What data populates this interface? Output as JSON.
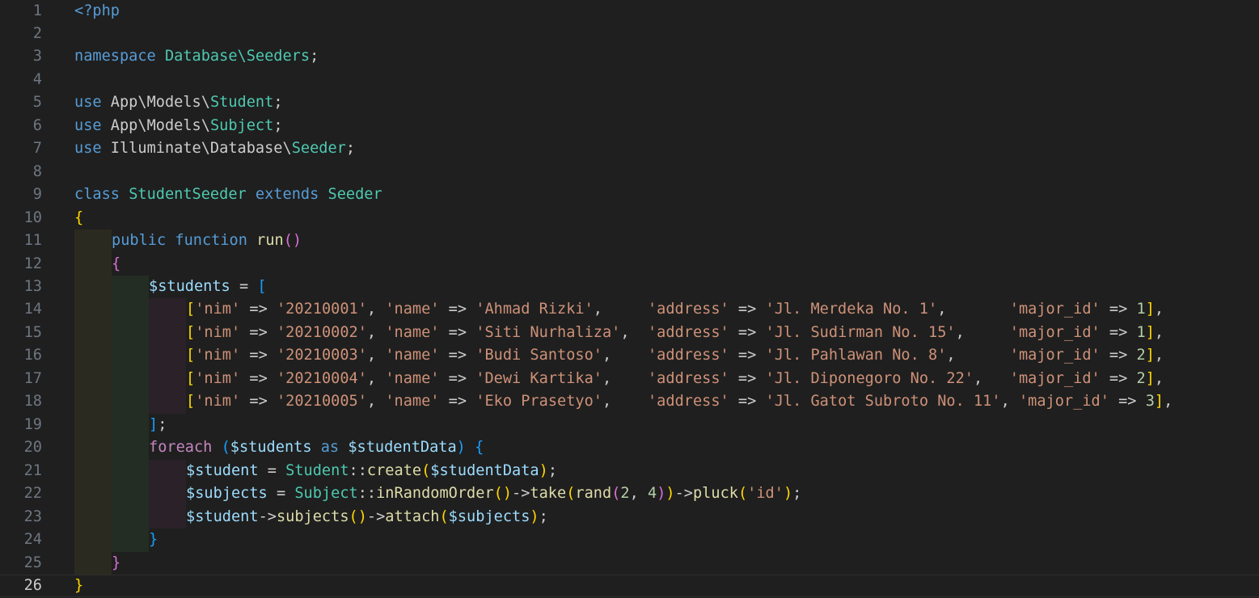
{
  "editor": {
    "language": "php",
    "current_line": 26,
    "colors": {
      "background": "#1f1f1f",
      "keyword": "#569cd6",
      "control": "#c586c0",
      "type": "#4ec9b0",
      "func": "#dcdcaa",
      "variable": "#9cdcfe",
      "string": "#ce9178",
      "number": "#b5cea8",
      "text": "#cccccc",
      "bracket1": "#ffd700",
      "bracket2": "#da70d6",
      "bracket3": "#179fff"
    },
    "lines": [
      {
        "n": "1",
        "indent": 0,
        "tokens": [
          [
            "<?php",
            "keyword"
          ]
        ]
      },
      {
        "n": "2",
        "indent": 0,
        "tokens": []
      },
      {
        "n": "3",
        "indent": 0,
        "tokens": [
          [
            "namespace",
            "keyword"
          ],
          [
            " ",
            "text"
          ],
          [
            "Database\\Seeders",
            "type"
          ],
          [
            ";",
            "text"
          ]
        ]
      },
      {
        "n": "4",
        "indent": 0,
        "tokens": []
      },
      {
        "n": "5",
        "indent": 0,
        "tokens": [
          [
            "use",
            "keyword"
          ],
          [
            " App\\Models\\",
            "text"
          ],
          [
            "Student",
            "type"
          ],
          [
            ";",
            "text"
          ]
        ]
      },
      {
        "n": "6",
        "indent": 0,
        "tokens": [
          [
            "use",
            "keyword"
          ],
          [
            " App\\Models\\",
            "text"
          ],
          [
            "Subject",
            "type"
          ],
          [
            ";",
            "text"
          ]
        ]
      },
      {
        "n": "7",
        "indent": 0,
        "tokens": [
          [
            "use",
            "keyword"
          ],
          [
            " Illuminate\\Database\\",
            "text"
          ],
          [
            "Seeder",
            "type"
          ],
          [
            ";",
            "text"
          ]
        ]
      },
      {
        "n": "8",
        "indent": 0,
        "tokens": []
      },
      {
        "n": "9",
        "indent": 0,
        "tokens": [
          [
            "class",
            "keyword"
          ],
          [
            " ",
            "text"
          ],
          [
            "StudentSeeder",
            "type"
          ],
          [
            " ",
            "text"
          ],
          [
            "extends",
            "keyword"
          ],
          [
            " ",
            "text"
          ],
          [
            "Seeder",
            "type"
          ]
        ]
      },
      {
        "n": "10",
        "indent": 0,
        "tokens": [
          [
            "{",
            "bracket1"
          ]
        ]
      },
      {
        "n": "11",
        "indent": 1,
        "tokens": [
          [
            "public",
            "keyword"
          ],
          [
            " ",
            "text"
          ],
          [
            "function",
            "keyword"
          ],
          [
            " ",
            "text"
          ],
          [
            "run",
            "func"
          ],
          [
            "()",
            "bracket2"
          ]
        ]
      },
      {
        "n": "12",
        "indent": 1,
        "tokens": [
          [
            "{",
            "bracket2"
          ]
        ]
      },
      {
        "n": "13",
        "indent": 2,
        "tokens": [
          [
            "$students",
            "variable"
          ],
          [
            " = ",
            "text"
          ],
          [
            "[",
            "bracket3"
          ]
        ]
      },
      {
        "n": "14",
        "indent": 3,
        "tokens": [
          [
            "[",
            "bracket1"
          ],
          [
            "'nim'",
            "string"
          ],
          [
            " => ",
            "text"
          ],
          [
            "'20210001'",
            "string"
          ],
          [
            ", ",
            "text"
          ],
          [
            "'name'",
            "string"
          ],
          [
            " => ",
            "text"
          ],
          [
            "'Ahmad Rizki'",
            "string"
          ],
          [
            ",     ",
            "text"
          ],
          [
            "'address'",
            "string"
          ],
          [
            " => ",
            "text"
          ],
          [
            "'Jl. Merdeka No. 1'",
            "string"
          ],
          [
            ",       ",
            "text"
          ],
          [
            "'major_id'",
            "string"
          ],
          [
            " => ",
            "text"
          ],
          [
            "1",
            "number"
          ],
          [
            "]",
            "bracket1"
          ],
          [
            ",",
            "text"
          ]
        ]
      },
      {
        "n": "15",
        "indent": 3,
        "tokens": [
          [
            "[",
            "bracket1"
          ],
          [
            "'nim'",
            "string"
          ],
          [
            " => ",
            "text"
          ],
          [
            "'20210002'",
            "string"
          ],
          [
            ", ",
            "text"
          ],
          [
            "'name'",
            "string"
          ],
          [
            " => ",
            "text"
          ],
          [
            "'Siti Nurhaliza'",
            "string"
          ],
          [
            ",  ",
            "text"
          ],
          [
            "'address'",
            "string"
          ],
          [
            " => ",
            "text"
          ],
          [
            "'Jl. Sudirman No. 15'",
            "string"
          ],
          [
            ",     ",
            "text"
          ],
          [
            "'major_id'",
            "string"
          ],
          [
            " => ",
            "text"
          ],
          [
            "1",
            "number"
          ],
          [
            "]",
            "bracket1"
          ],
          [
            ",",
            "text"
          ]
        ]
      },
      {
        "n": "16",
        "indent": 3,
        "tokens": [
          [
            "[",
            "bracket1"
          ],
          [
            "'nim'",
            "string"
          ],
          [
            " => ",
            "text"
          ],
          [
            "'20210003'",
            "string"
          ],
          [
            ", ",
            "text"
          ],
          [
            "'name'",
            "string"
          ],
          [
            " => ",
            "text"
          ],
          [
            "'Budi Santoso'",
            "string"
          ],
          [
            ",    ",
            "text"
          ],
          [
            "'address'",
            "string"
          ],
          [
            " => ",
            "text"
          ],
          [
            "'Jl. Pahlawan No. 8'",
            "string"
          ],
          [
            ",      ",
            "text"
          ],
          [
            "'major_id'",
            "string"
          ],
          [
            " => ",
            "text"
          ],
          [
            "2",
            "number"
          ],
          [
            "]",
            "bracket1"
          ],
          [
            ",",
            "text"
          ]
        ]
      },
      {
        "n": "17",
        "indent": 3,
        "tokens": [
          [
            "[",
            "bracket1"
          ],
          [
            "'nim'",
            "string"
          ],
          [
            " => ",
            "text"
          ],
          [
            "'20210004'",
            "string"
          ],
          [
            ", ",
            "text"
          ],
          [
            "'name'",
            "string"
          ],
          [
            " => ",
            "text"
          ],
          [
            "'Dewi Kartika'",
            "string"
          ],
          [
            ",    ",
            "text"
          ],
          [
            "'address'",
            "string"
          ],
          [
            " => ",
            "text"
          ],
          [
            "'Jl. Diponegoro No. 22'",
            "string"
          ],
          [
            ",   ",
            "text"
          ],
          [
            "'major_id'",
            "string"
          ],
          [
            " => ",
            "text"
          ],
          [
            "2",
            "number"
          ],
          [
            "]",
            "bracket1"
          ],
          [
            ",",
            "text"
          ]
        ]
      },
      {
        "n": "18",
        "indent": 3,
        "tokens": [
          [
            "[",
            "bracket1"
          ],
          [
            "'nim'",
            "string"
          ],
          [
            " => ",
            "text"
          ],
          [
            "'20210005'",
            "string"
          ],
          [
            ", ",
            "text"
          ],
          [
            "'name'",
            "string"
          ],
          [
            " => ",
            "text"
          ],
          [
            "'Eko Prasetyo'",
            "string"
          ],
          [
            ",    ",
            "text"
          ],
          [
            "'address'",
            "string"
          ],
          [
            " => ",
            "text"
          ],
          [
            "'Jl. Gatot Subroto No. 11'",
            "string"
          ],
          [
            ", ",
            "text"
          ],
          [
            "'major_id'",
            "string"
          ],
          [
            " => ",
            "text"
          ],
          [
            "3",
            "number"
          ],
          [
            "]",
            "bracket1"
          ],
          [
            ",",
            "text"
          ]
        ]
      },
      {
        "n": "19",
        "indent": 2,
        "tokens": [
          [
            "]",
            "bracket3"
          ],
          [
            ";",
            "text"
          ]
        ]
      },
      {
        "n": "20",
        "indent": 2,
        "tokens": [
          [
            "foreach",
            "control"
          ],
          [
            " ",
            "text"
          ],
          [
            "(",
            "bracket3"
          ],
          [
            "$students",
            "variable"
          ],
          [
            " ",
            "text"
          ],
          [
            "as",
            "keyword"
          ],
          [
            " ",
            "text"
          ],
          [
            "$studentData",
            "variable"
          ],
          [
            ")",
            "bracket3"
          ],
          [
            " ",
            "text"
          ],
          [
            "{",
            "bracket3"
          ]
        ]
      },
      {
        "n": "21",
        "indent": 3,
        "tokens": [
          [
            "$student",
            "variable"
          ],
          [
            " = ",
            "text"
          ],
          [
            "Student",
            "type"
          ],
          [
            "::",
            "text"
          ],
          [
            "create",
            "func"
          ],
          [
            "(",
            "bracket1"
          ],
          [
            "$studentData",
            "variable"
          ],
          [
            ")",
            "bracket1"
          ],
          [
            ";",
            "text"
          ]
        ]
      },
      {
        "n": "22",
        "indent": 3,
        "tokens": [
          [
            "$subjects",
            "variable"
          ],
          [
            " = ",
            "text"
          ],
          [
            "Subject",
            "type"
          ],
          [
            "::",
            "text"
          ],
          [
            "inRandomOrder",
            "func"
          ],
          [
            "()",
            "bracket1"
          ],
          [
            "->",
            "text"
          ],
          [
            "take",
            "func"
          ],
          [
            "(",
            "bracket1"
          ],
          [
            "rand",
            "func"
          ],
          [
            "(",
            "bracket2"
          ],
          [
            "2",
            "number"
          ],
          [
            ", ",
            "text"
          ],
          [
            "4",
            "number"
          ],
          [
            ")",
            "bracket2"
          ],
          [
            ")",
            "bracket1"
          ],
          [
            "->",
            "text"
          ],
          [
            "pluck",
            "func"
          ],
          [
            "(",
            "bracket1"
          ],
          [
            "'id'",
            "string"
          ],
          [
            ")",
            "bracket1"
          ],
          [
            ";",
            "text"
          ]
        ]
      },
      {
        "n": "23",
        "indent": 3,
        "tokens": [
          [
            "$student",
            "variable"
          ],
          [
            "->",
            "text"
          ],
          [
            "subjects",
            "func"
          ],
          [
            "()",
            "bracket1"
          ],
          [
            "->",
            "text"
          ],
          [
            "attach",
            "func"
          ],
          [
            "(",
            "bracket1"
          ],
          [
            "$subjects",
            "variable"
          ],
          [
            ")",
            "bracket1"
          ],
          [
            ";",
            "text"
          ]
        ]
      },
      {
        "n": "24",
        "indent": 2,
        "tokens": [
          [
            "}",
            "bracket3"
          ]
        ]
      },
      {
        "n": "25",
        "indent": 1,
        "tokens": [
          [
            "}",
            "bracket2"
          ]
        ]
      },
      {
        "n": "26",
        "indent": 0,
        "tokens": [
          [
            "}",
            "bracket1"
          ]
        ]
      }
    ]
  }
}
